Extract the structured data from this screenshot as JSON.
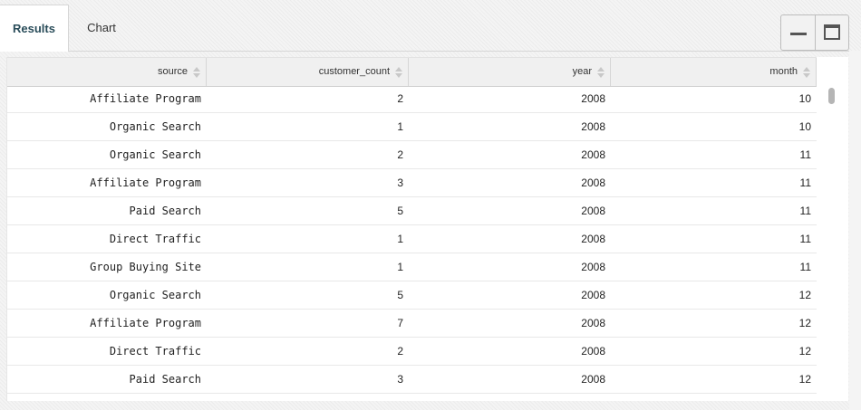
{
  "tabs": [
    {
      "label": "Results"
    },
    {
      "label": "Chart"
    }
  ],
  "window_controls": {
    "minimize_icon": "minimize-icon",
    "maximize_icon": "maximize-icon"
  },
  "table": {
    "columns": [
      "source",
      "customer_count",
      "year",
      "month"
    ],
    "rows": [
      [
        "Affiliate Program",
        "2",
        "2008",
        "10"
      ],
      [
        "Organic Search",
        "1",
        "2008",
        "10"
      ],
      [
        "Organic Search",
        "2",
        "2008",
        "11"
      ],
      [
        "Affiliate Program",
        "3",
        "2008",
        "11"
      ],
      [
        "Paid Search",
        "5",
        "2008",
        "11"
      ],
      [
        "Direct Traffic",
        "1",
        "2008",
        "11"
      ],
      [
        "Group Buying Site",
        "1",
        "2008",
        "11"
      ],
      [
        "Organic Search",
        "5",
        "2008",
        "12"
      ],
      [
        "Affiliate Program",
        "7",
        "2008",
        "12"
      ],
      [
        "Direct Traffic",
        "2",
        "2008",
        "12"
      ],
      [
        "Paid Search",
        "3",
        "2008",
        "12"
      ]
    ]
  },
  "colors": {
    "active_tab_text": "#2a4d5a",
    "header_bg": "#f0f0f0"
  }
}
